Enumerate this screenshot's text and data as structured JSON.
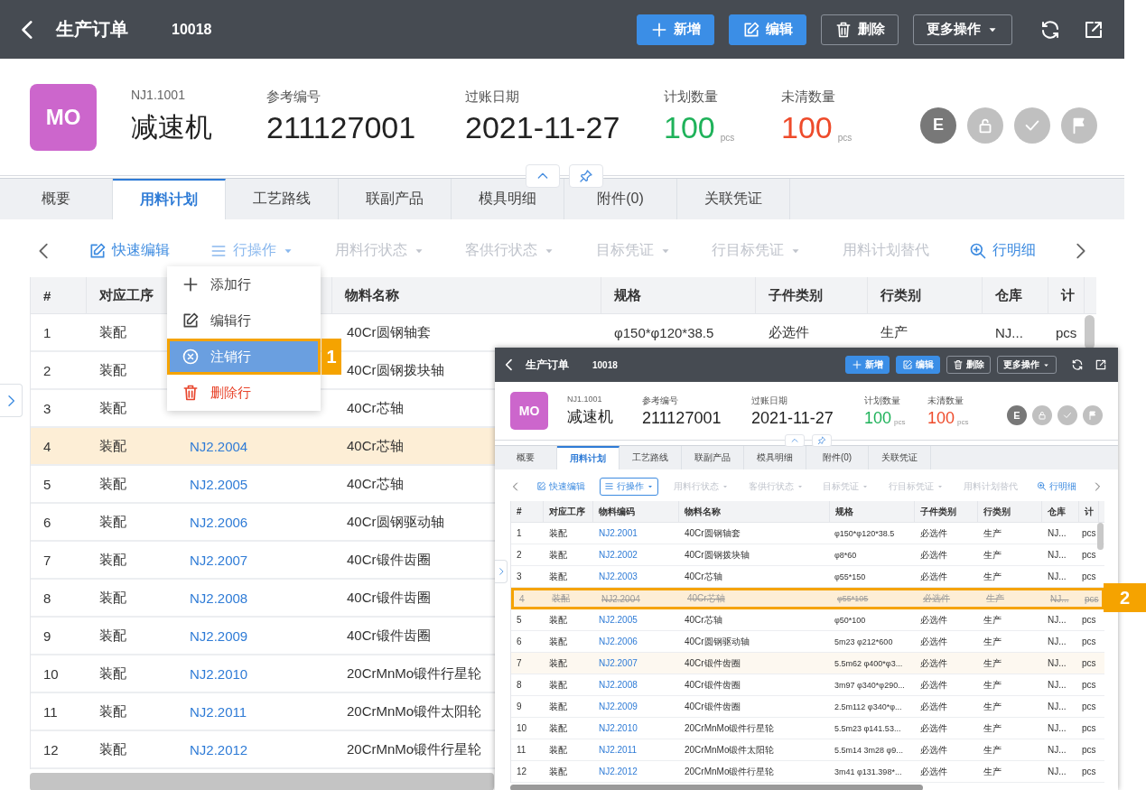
{
  "main": {
    "header": {
      "title": "生产订单",
      "id": "10018",
      "buttons": [
        {
          "label": "新增",
          "kind": "primary"
        },
        {
          "label": "编辑",
          "kind": "primary"
        },
        {
          "label": "删除",
          "kind": "outline"
        },
        {
          "label": "更多操作",
          "kind": "dropdown"
        }
      ]
    },
    "info": {
      "avatar": "MO",
      "code": "NJ1.1001",
      "name": "减速机",
      "status_letter": "E",
      "fields": [
        {
          "label": "参考编号",
          "value": "211127001"
        },
        {
          "label": "过账日期",
          "value": "2021-11-27"
        },
        {
          "label": "计划数量",
          "value": "100",
          "unit": "pcs",
          "color": "#1fb25a"
        },
        {
          "label": "未清数量",
          "value": "100",
          "unit": "pcs",
          "color": "#ee4b2b"
        }
      ]
    },
    "tabs": [
      {
        "label": "概要",
        "selected": false
      },
      {
        "label": "用料计划",
        "selected": true
      },
      {
        "label": "工艺路线",
        "selected": false
      },
      {
        "label": "联副产品",
        "selected": false
      },
      {
        "label": "模具明细",
        "selected": false
      },
      {
        "label": "附件(0)",
        "selected": false
      },
      {
        "label": "关联凭证",
        "selected": false
      }
    ],
    "toolbar": [
      {
        "label": "快速编辑",
        "disabled": false,
        "dropdown": false
      },
      {
        "label": "行操作",
        "disabled": false,
        "dropdown": true,
        "open": true
      },
      {
        "label": "用料行状态",
        "disabled": true,
        "dropdown": true
      },
      {
        "label": "客供行状态",
        "disabled": true,
        "dropdown": true
      },
      {
        "label": "目标凭证",
        "disabled": true,
        "dropdown": true
      },
      {
        "label": "行目标凭证",
        "disabled": true,
        "dropdown": true
      },
      {
        "label": "用料计划替代",
        "disabled": true,
        "dropdown": false
      },
      {
        "label": "行明细",
        "disabled": false,
        "dropdown": false
      }
    ],
    "row_menu": [
      {
        "label": "添加行",
        "selected": false,
        "danger": false
      },
      {
        "label": "编辑行",
        "selected": false,
        "danger": false
      },
      {
        "label": "注销行",
        "selected": true,
        "danger": false
      },
      {
        "label": "删除行",
        "selected": false,
        "danger": true
      }
    ],
    "callout": {
      "label": "1"
    },
    "table": {
      "columns": [
        {
          "label": "#"
        },
        {
          "label": "对应工序"
        },
        {},
        {
          "label": "物料名称"
        },
        {
          "label": "规格"
        },
        {
          "label": "子件类别"
        },
        {
          "label": "行类别"
        },
        {
          "label": "仓库"
        },
        {
          "label": "计"
        }
      ],
      "rows": [
        {
          "no": "1",
          "op": "装配",
          "name": "40Cr圆钢轴套",
          "spec": "φ150*φ120*38.5",
          "part": "必选件",
          "line": "生产",
          "wh": "NJ...",
          "unit": "pcs",
          "selected": false,
          "cancelled": false,
          "hovered": false
        },
        {
          "no": "2",
          "op": "装配",
          "name": "40Cr圆钢拨块轴",
          "selected": false,
          "cancelled": false,
          "hovered": false
        },
        {
          "no": "3",
          "op": "装配",
          "name": "40Cr芯轴",
          "selected": false,
          "cancelled": false,
          "hovered": false
        },
        {
          "no": "4",
          "op": "装配",
          "code": "NJ2.2004",
          "name": "40Cr芯轴",
          "selected": true,
          "cancelled": false,
          "hovered": false
        },
        {
          "no": "5",
          "op": "装配",
          "code": "NJ2.2005",
          "name": "40Cr芯轴",
          "selected": false,
          "cancelled": false,
          "hovered": false
        },
        {
          "no": "6",
          "op": "装配",
          "code": "NJ2.2006",
          "name": "40Cr圆钢驱动轴",
          "selected": false,
          "cancelled": false,
          "hovered": false
        },
        {
          "no": "7",
          "op": "装配",
          "code": "NJ2.2007",
          "name": "40Cr锻件齿圈",
          "selected": false,
          "cancelled": false,
          "hovered": false
        },
        {
          "no": "8",
          "op": "装配",
          "code": "NJ2.2008",
          "name": "40Cr锻件齿圈",
          "selected": false,
          "cancelled": false,
          "hovered": false
        },
        {
          "no": "9",
          "op": "装配",
          "code": "NJ2.2009",
          "name": "40Cr锻件齿圈",
          "selected": false,
          "cancelled": false,
          "hovered": false
        },
        {
          "no": "10",
          "op": "装配",
          "code": "NJ2.2010",
          "name": "20CrMnMo锻件行星轮",
          "selected": false,
          "cancelled": false,
          "hovered": false
        },
        {
          "no": "11",
          "op": "装配",
          "code": "NJ2.2011",
          "name": "20CrMnMo锻件太阳轮",
          "selected": false,
          "cancelled": false,
          "hovered": false
        },
        {
          "no": "12",
          "op": "装配",
          "code": "NJ2.2012",
          "name": "20CrMnMo锻件行星轮",
          "selected": false,
          "cancelled": false,
          "hovered": false
        }
      ]
    }
  },
  "inset": {
    "header": {
      "title": "生产订单",
      "id": "10018",
      "buttons": [
        {
          "label": "新增",
          "kind": "primary"
        },
        {
          "label": "编辑",
          "kind": "primary"
        },
        {
          "label": "删除",
          "kind": "outline"
        },
        {
          "label": "更多操作",
          "kind": "dropdown"
        }
      ]
    },
    "info": {
      "avatar": "MO",
      "code": "NJ1.1001",
      "name": "减速机",
      "status_letter": "E",
      "fields": [
        {
          "label": "参考编号",
          "value": "211127001"
        },
        {
          "label": "过账日期",
          "value": "2021-11-27"
        },
        {
          "label": "计划数量",
          "value": "100",
          "unit": "pcs",
          "color": "#1fb25a"
        },
        {
          "label": "未清数量",
          "value": "100",
          "unit": "pcs",
          "color": "#ee4b2b"
        }
      ]
    },
    "tabs": [
      {
        "label": "概要",
        "selected": false
      },
      {
        "label": "用料计划",
        "selected": true
      },
      {
        "label": "工艺路线",
        "selected": false
      },
      {
        "label": "联副产品",
        "selected": false
      },
      {
        "label": "模具明细",
        "selected": false
      },
      {
        "label": "附件(0)",
        "selected": false
      },
      {
        "label": "关联凭证",
        "selected": false
      }
    ],
    "toolbar": [
      {
        "label": "快速编辑",
        "disabled": false,
        "dropdown": false
      },
      {
        "label": "行操作",
        "disabled": false,
        "dropdown": true,
        "focused": true
      },
      {
        "label": "用料行状态",
        "disabled": true,
        "dropdown": true
      },
      {
        "label": "客供行状态",
        "disabled": true,
        "dropdown": true
      },
      {
        "label": "目标凭证",
        "disabled": true,
        "dropdown": true
      },
      {
        "label": "行目标凭证",
        "disabled": true,
        "dropdown": true
      },
      {
        "label": "用料计划替代",
        "disabled": true,
        "dropdown": false
      },
      {
        "label": "行明细",
        "disabled": false,
        "dropdown": false
      }
    ],
    "callout": {
      "label": "2"
    },
    "table": {
      "columns": [
        {
          "label": "#"
        },
        {
          "label": "对应工序"
        },
        {
          "label": "物料编码"
        },
        {
          "label": "物料名称"
        },
        {
          "label": "规格"
        },
        {
          "label": "子件类别"
        },
        {
          "label": "行类别"
        },
        {
          "label": "仓库"
        },
        {
          "label": "计"
        }
      ],
      "rows": [
        {
          "no": "1",
          "op": "装配",
          "code": "NJ2.2001",
          "name": "40Cr圆钢轴套",
          "spec": "φ150*φ120*38.5",
          "part": "必选件",
          "line": "生产",
          "wh": "NJ...",
          "unit": "pcs",
          "selected": false,
          "cancelled": false,
          "hovered": false
        },
        {
          "no": "2",
          "op": "装配",
          "code": "NJ2.2002",
          "name": "40Cr圆钢拨块轴",
          "spec": "φ8*60",
          "part": "必选件",
          "line": "生产",
          "wh": "NJ...",
          "unit": "pcs",
          "selected": false,
          "cancelled": false,
          "hovered": false
        },
        {
          "no": "3",
          "op": "装配",
          "code": "NJ2.2003",
          "name": "40Cr芯轴",
          "spec": "φ55*150",
          "part": "必选件",
          "line": "生产",
          "wh": "NJ...",
          "unit": "pcs",
          "selected": false,
          "cancelled": false,
          "hovered": false
        },
        {
          "no": "4",
          "op": "装配",
          "code": "NJ2.2004",
          "name": "40Cr芯轴",
          "spec": "φ55*105",
          "part": "必选件",
          "line": "生产",
          "wh": "NJ...",
          "unit": "pcs",
          "selected": true,
          "cancelled": true,
          "hovered": false
        },
        {
          "no": "5",
          "op": "装配",
          "code": "NJ2.2005",
          "name": "40Cr芯轴",
          "spec": "φ50*100",
          "part": "必选件",
          "line": "生产",
          "wh": "NJ...",
          "unit": "pcs",
          "selected": false,
          "cancelled": false,
          "hovered": false
        },
        {
          "no": "6",
          "op": "装配",
          "code": "NJ2.2006",
          "name": "40Cr圆钢驱动轴",
          "spec": "5m23 φ212*600",
          "part": "必选件",
          "line": "生产",
          "wh": "NJ...",
          "unit": "pcs",
          "selected": false,
          "cancelled": false,
          "hovered": false
        },
        {
          "no": "7",
          "op": "装配",
          "code": "NJ2.2007",
          "name": "40Cr锻件齿圈",
          "spec": "5.5m62 φ400*φ3...",
          "part": "必选件",
          "line": "生产",
          "wh": "NJ...",
          "unit": "pcs",
          "selected": false,
          "cancelled": false,
          "hovered": true
        },
        {
          "no": "8",
          "op": "装配",
          "code": "NJ2.2008",
          "name": "40Cr锻件齿圈",
          "spec": "3m97 φ340*φ290...",
          "part": "必选件",
          "line": "生产",
          "wh": "NJ...",
          "unit": "pcs",
          "selected": false,
          "cancelled": false,
          "hovered": false
        },
        {
          "no": "9",
          "op": "装配",
          "code": "NJ2.2009",
          "name": "40Cr锻件齿圈",
          "spec": "2.5m112 φ340*φ...",
          "part": "必选件",
          "line": "生产",
          "wh": "NJ...",
          "unit": "pcs",
          "selected": false,
          "cancelled": false,
          "hovered": false
        },
        {
          "no": "10",
          "op": "装配",
          "code": "NJ2.2010",
          "name": "20CrMnMo锻件行星轮",
          "spec": "5.5m23 φ141.53...",
          "part": "必选件",
          "line": "生产",
          "wh": "NJ...",
          "unit": "pcs",
          "selected": false,
          "cancelled": false,
          "hovered": false
        },
        {
          "no": "11",
          "op": "装配",
          "code": "NJ2.2011",
          "name": "20CrMnMo锻件太阳轮",
          "spec": "5.5m14 3m28 φ9...",
          "part": "必选件",
          "line": "生产",
          "wh": "NJ...",
          "unit": "pcs",
          "selected": false,
          "cancelled": false,
          "hovered": false
        },
        {
          "no": "12",
          "op": "装配",
          "code": "NJ2.2012",
          "name": "20CrMnMo锻件行星轮",
          "spec": "3m41 φ131.398*...",
          "part": "必选件",
          "line": "生产",
          "wh": "NJ...",
          "unit": "pcs",
          "selected": false,
          "cancelled": false,
          "hovered": false
        }
      ]
    }
  }
}
